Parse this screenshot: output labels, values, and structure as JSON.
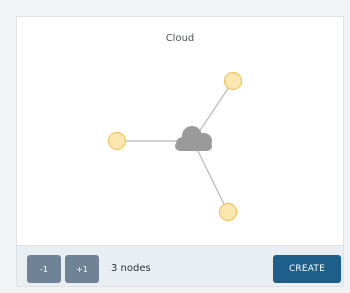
{
  "panel": {
    "title": "Cloud"
  },
  "graph": {
    "center_icon": "cloud-icon",
    "node_count": 3,
    "colors": {
      "node_fill": "#fde7b0",
      "node_stroke": "#f2c45f",
      "edge": "#b9b9b9",
      "cloud": "#9a9a9a"
    }
  },
  "footer": {
    "decrement_label": "-1",
    "increment_label": "+1",
    "count_text": "3 nodes",
    "create_label": "CREATE"
  },
  "colors": {
    "page_background": "#f2f3f5",
    "footer_background": "#e9eef3",
    "step_button": "#6f8296",
    "create_button": "#1d5f8a"
  }
}
